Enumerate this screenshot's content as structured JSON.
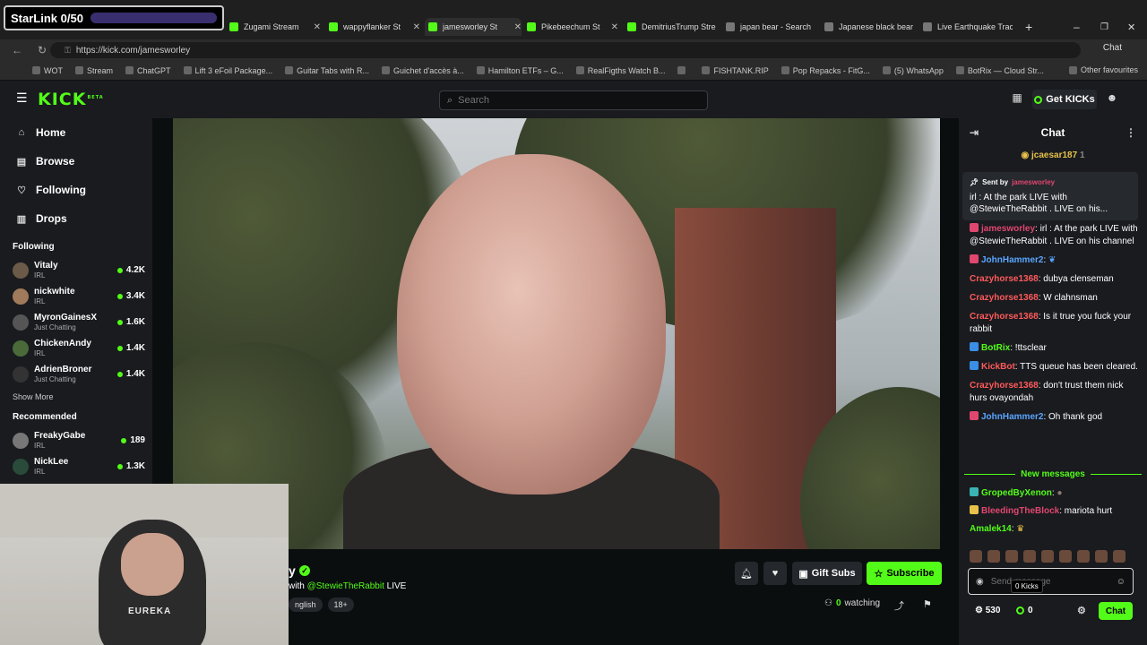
{
  "overlay": {
    "starlink_label": "StarLink 0/50"
  },
  "browser": {
    "tabs": [
      {
        "label": "Zugami Stream"
      },
      {
        "label": "wappyflanker St"
      },
      {
        "label": "jamesworley St"
      },
      {
        "label": "Pikebeechum St"
      },
      {
        "label": "DemitriusTrump Stre"
      },
      {
        "label": "japan bear - Search"
      },
      {
        "label": "Japanese black bear"
      },
      {
        "label": "Live Earthquake Trac"
      }
    ],
    "url": "https://kick.com/jamesworley",
    "chat_button": "Chat",
    "bookmarks": [
      "WOT",
      "Stream",
      "ChatGPT",
      "Lift 3 eFoil Package...",
      "Guitar Tabs with R...",
      "Guichet d'accès à...",
      "Hamilton ETFs – G...",
      "RealFigths Watch B...",
      "",
      "FISHTANK.RIP",
      "Pop Repacks - FitG...",
      "(5) WhatsApp",
      "BotRix — Cloud Str..."
    ],
    "other_favourites": "Other favourites"
  },
  "header": {
    "logo": "KICK",
    "logo_badge": "BETA",
    "search_placeholder": "Search",
    "get_kicks": "Get KICKs"
  },
  "sidebar": {
    "nav": [
      {
        "label": "Home",
        "icon": "home-icon"
      },
      {
        "label": "Browse",
        "icon": "browse-icon"
      },
      {
        "label": "Following",
        "icon": "heart-icon"
      },
      {
        "label": "Drops",
        "icon": "drops-icon"
      }
    ],
    "following_title": "Following",
    "following": [
      {
        "name": "Vitaly",
        "category": "IRL",
        "viewers": "4.2K"
      },
      {
        "name": "nickwhite",
        "category": "IRL",
        "viewers": "3.4K"
      },
      {
        "name": "MyronGainesX",
        "category": "Just Chatting",
        "viewers": "1.6K"
      },
      {
        "name": "ChickenAndy",
        "category": "IRL",
        "viewers": "1.4K"
      },
      {
        "name": "AdrienBroner",
        "category": "Just Chatting",
        "viewers": "1.4K"
      }
    ],
    "show_more": "Show More",
    "recommended_title": "Recommended",
    "recommended": [
      {
        "name": "FreakyGabe",
        "category": "IRL",
        "viewers": "189"
      },
      {
        "name": "NickLee",
        "category": "IRL",
        "viewers": "1.3K"
      }
    ]
  },
  "stream": {
    "streamer_name_visible": "y",
    "title_prefix": "with ",
    "title_mention": "@StewieTheRabbit",
    "title_suffix": " LIVE",
    "tags": [
      "nglish",
      "18+"
    ],
    "gift_subs": "Gift Subs",
    "subscribe": "Subscribe",
    "watching_count": "0",
    "watching_label": "watching",
    "webcam_shirt_text": "EUREKA"
  },
  "chat": {
    "title": "Chat",
    "top_gifter": "jcaesar187",
    "top_gifter_count": "1",
    "pinned_sent_by": "Sent by",
    "pinned_user": "jamesworley",
    "pinned_text": "irl : At the park LIVE with @StewieTheRabbit . LIVE on his...",
    "messages": [
      {
        "user": "jamesworley",
        "text": ": irl : At the park LIVE with @StewieTheRabbit . LIVE on his channel"
      },
      {
        "user": "JohnHammer2",
        "text": ":"
      },
      {
        "user": "Crazyhorse1368",
        "text": ": dubya clenseman"
      },
      {
        "user": "Crazyhorse1368",
        "text": ": W clahnsman"
      },
      {
        "user": "Crazyhorse1368",
        "text": ": Is it true you fuck your rabbit"
      },
      {
        "user": "BotRix",
        "text": ": !ttsclear"
      },
      {
        "user": "KickBot",
        "text": ": TTS queue has been cleared."
      },
      {
        "user": "Crazyhorse1368",
        "text": ": don't trust them nick hurs ovayondah"
      },
      {
        "user": "JohnHammer2",
        "text": ": Oh thank god"
      }
    ],
    "new_messages": "New messages",
    "messages_after": [
      {
        "user": "GropedByXenon",
        "text": ":"
      },
      {
        "user": "BleedingTheBlock",
        "text": ": mariota hurt"
      },
      {
        "user": "Amalek14",
        "text": ":"
      }
    ],
    "input_placeholder": "Send message",
    "tooltip": "0 Kicks",
    "points": "530",
    "kicks": "0",
    "send_label": "Chat"
  },
  "colors": {
    "accent": "#53fc18",
    "bg": "#0b0e0f",
    "panel": "#191b1f"
  }
}
